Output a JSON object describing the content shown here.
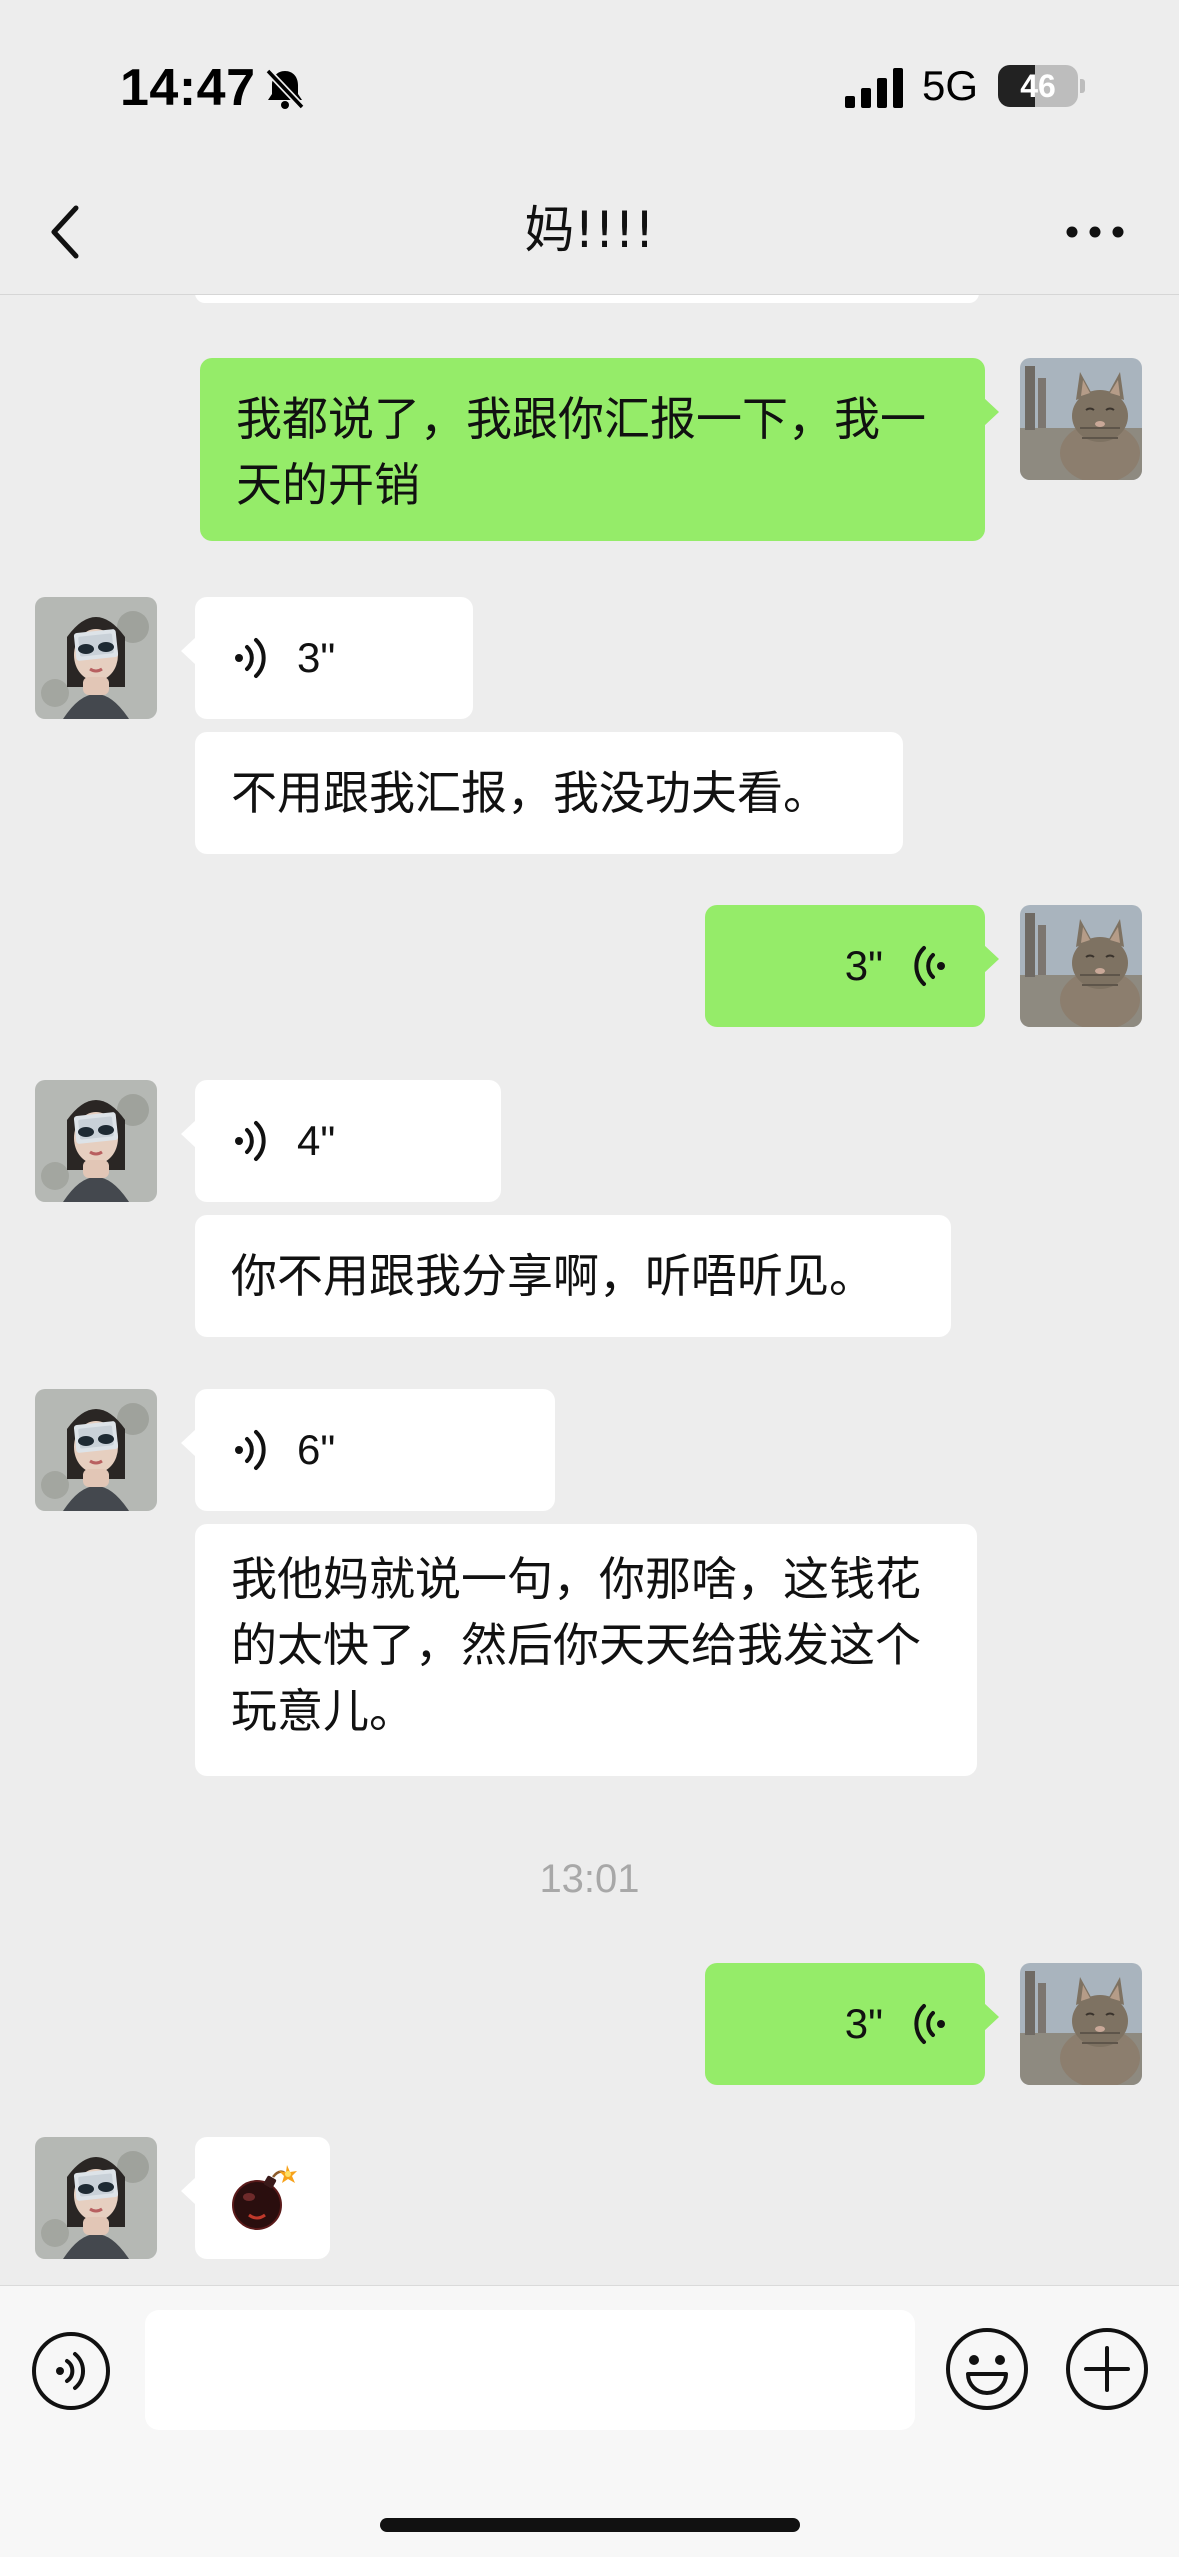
{
  "status_bar": {
    "time": "14:47",
    "network": "5G",
    "battery_level": "46",
    "battery_fraction": 0.46
  },
  "nav": {
    "title": "妈!!!!"
  },
  "messages": {
    "m1_text": "我都说了，我跟你汇报一下，我一天的开销",
    "m2_voice_duration": "3\"",
    "m2_text": "不用跟我汇报，我没功夫看。",
    "m3_voice_duration": "3\"",
    "m4_voice_duration": "4\"",
    "m4_text": "你不用跟我分享啊，听唔听见。",
    "m5_voice_duration": "6\"",
    "m5_text": "我他妈就说一句，你那啥，这钱花的太快了，然后你天天给我发这个玩意儿。",
    "timestamp": "13:01",
    "m6_voice_duration": "3\"",
    "m7_sticker": "bomb-emoji"
  },
  "input_bar": {
    "value": "",
    "placeholder": ""
  },
  "colors": {
    "background": "#EDEDED",
    "outgoing_bubble": "#95EC69",
    "incoming_bubble": "#FFFFFF",
    "timestamp_text": "#A8A8A8"
  },
  "icons": {
    "status": [
      "bell-slash-icon",
      "signal-icon",
      "battery-icon"
    ],
    "nav": [
      "back-chevron-icon",
      "more-icon"
    ],
    "input": [
      "voice-toggle-icon",
      "emoji-icon",
      "plus-icon"
    ]
  }
}
